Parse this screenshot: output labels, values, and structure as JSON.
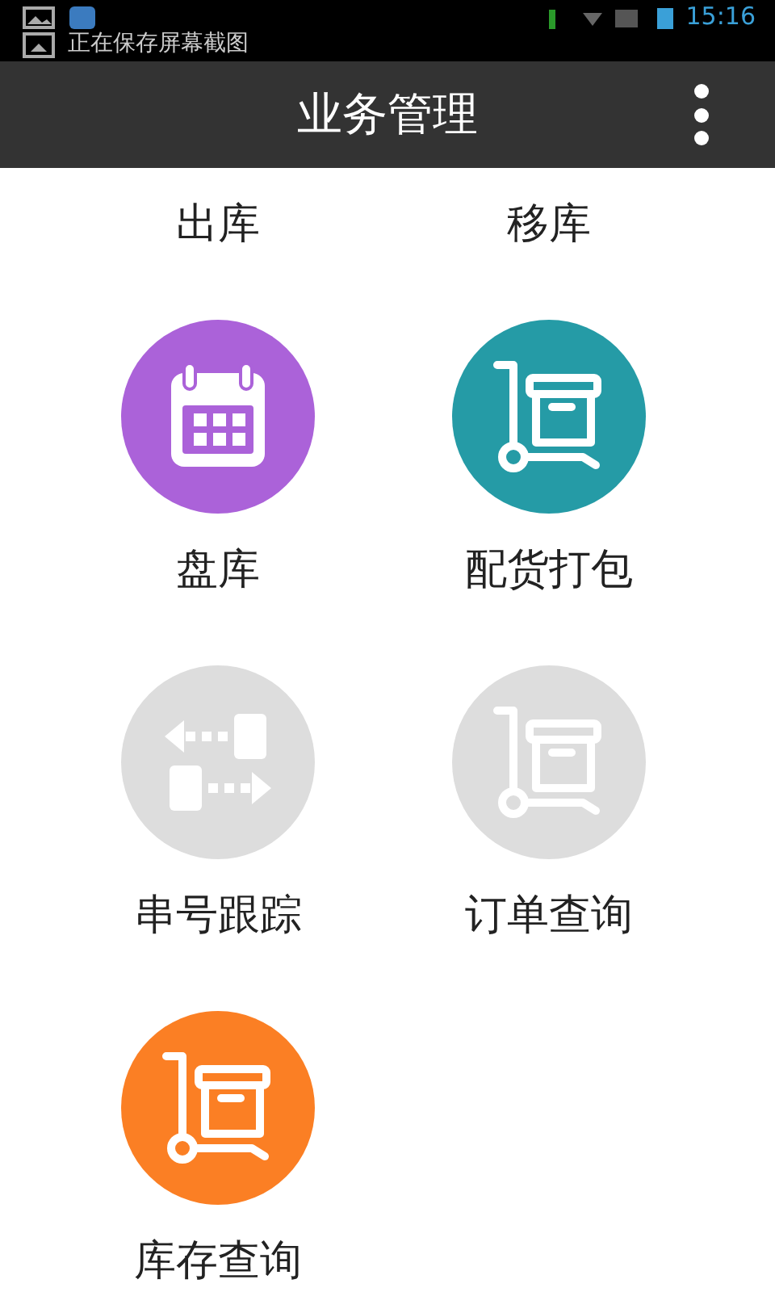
{
  "status_bar": {
    "notification": "正在保存屏幕截图",
    "time": "15:16"
  },
  "app_bar": {
    "title": "业务管理"
  },
  "partial_row": [
    {
      "label": "出库"
    },
    {
      "label": "移库"
    }
  ],
  "items": [
    {
      "label": "盘库",
      "kind": "calendar",
      "color": "#ab62d9"
    },
    {
      "label": "配货打包",
      "kind": "cart",
      "color": "#259ba6"
    },
    {
      "label": "串号跟踪",
      "kind": "transfer",
      "color": "#dddddd"
    },
    {
      "label": "订单查询",
      "kind": "cart",
      "color": "#dddddd"
    },
    {
      "label": "库存查询",
      "kind": "cart",
      "color": "#fb7f24"
    }
  ]
}
